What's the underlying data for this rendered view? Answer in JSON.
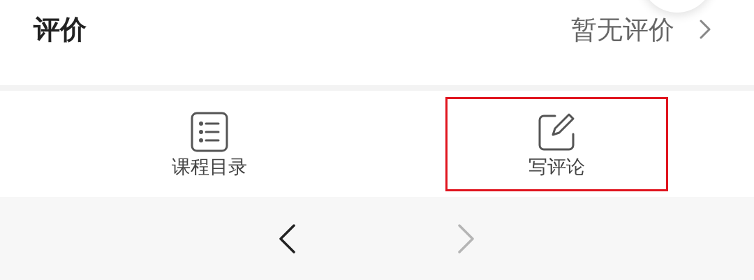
{
  "reviews": {
    "title": "评价",
    "summary": "暂无评价"
  },
  "actions": [
    {
      "kind": "list",
      "label": "课程目录",
      "highlighted": false
    },
    {
      "kind": "edit",
      "label": "写评论",
      "highlighted": true
    }
  ],
  "pager": [
    {
      "kind": "back",
      "disabled": false
    },
    {
      "kind": "forward",
      "disabled": true
    }
  ]
}
